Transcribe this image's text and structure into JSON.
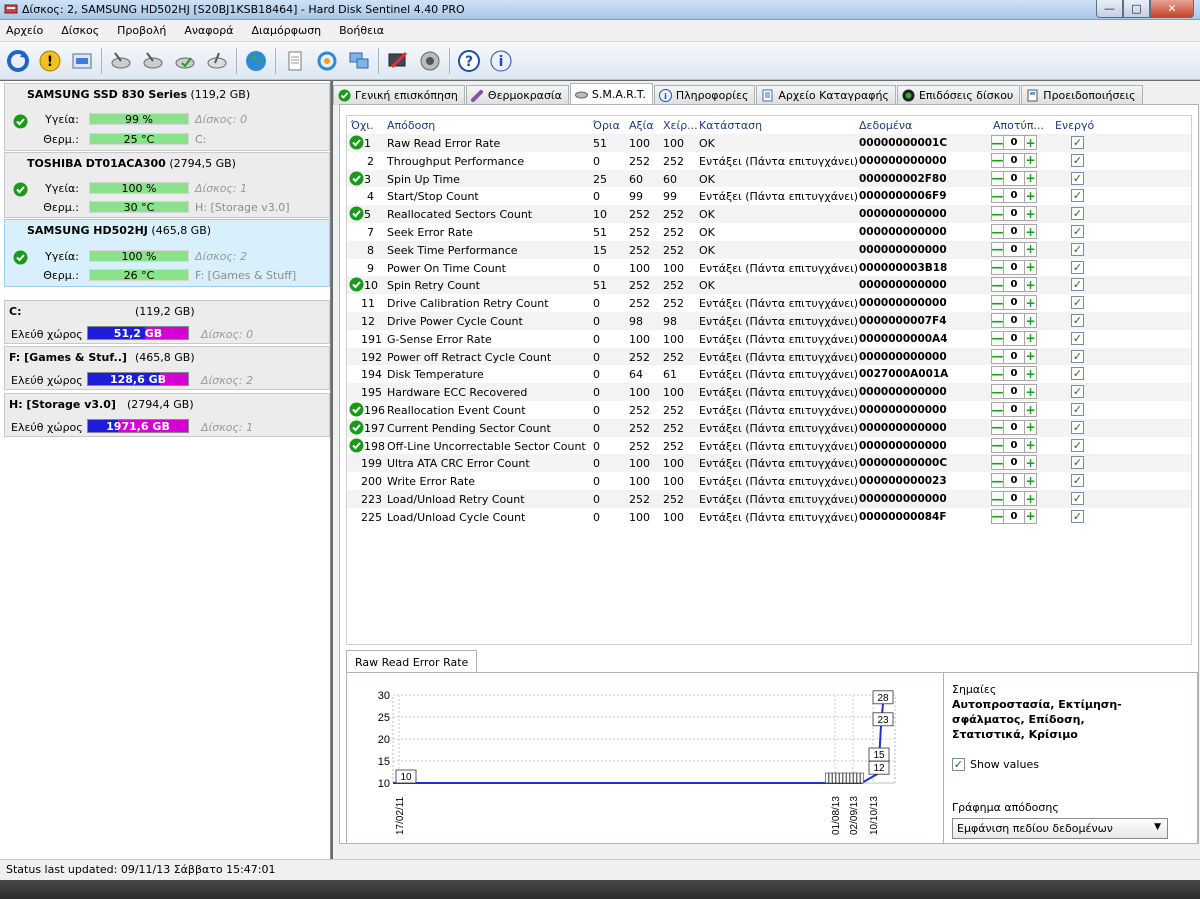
{
  "window": {
    "title": "Δίσκος: 2, SAMSUNG HD502HJ [S20BJ1KSB18464]  -  Hard Disk Sentinel 4.40 PRO"
  },
  "menu": [
    "Αρχείο",
    "Δίσκος",
    "Προβολή",
    "Αναφορά",
    "Διαμόρφωση",
    "Βοήθεια"
  ],
  "disks": [
    {
      "name": "SAMSUNG SSD 830 Series",
      "size": "(119,2 GB)",
      "health_label": "Υγεία:",
      "health": "99 %",
      "health_pct": 99,
      "disk_note": "Δίσκος: 0",
      "temp_label": "Θερμ.:",
      "temp": "25 °C",
      "vol_note": "C:"
    },
    {
      "name": "TOSHIBA DT01ACA300",
      "size": "(2794,5 GB)",
      "health_label": "Υγεία:",
      "health": "100 %",
      "health_pct": 100,
      "disk_note": "Δίσκος: 1",
      "temp_label": "Θερμ.:",
      "temp": "30 °C",
      "vol_note": "H: [Storage v3.0]"
    },
    {
      "name": "SAMSUNG HD502HJ",
      "size": "(465,8 GB)",
      "health_label": "Υγεία:",
      "health": "100 %",
      "health_pct": 100,
      "disk_note": "Δίσκος: 2",
      "temp_label": "Θερμ.:",
      "temp": "26 °C",
      "vol_note": "F: [Games & Stuff]"
    }
  ],
  "volumes": [
    {
      "name": "C:",
      "size": "(119,2 GB)",
      "free_label": "Ελεύθ χώρος",
      "free": "51,2 GB",
      "note": "Δίσκος: 0"
    },
    {
      "name": "F: [Games & Stuf..]",
      "size": "(465,8 GB)",
      "free_label": "Ελεύθ χώρος",
      "free": "128,6 GB",
      "note": "Δίσκος: 2"
    },
    {
      "name": "H: [Storage v3.0]",
      "size": "(2794,4 GB)",
      "free_label": "Ελεύθ χώρος",
      "free": "1971,6 GB",
      "note": "Δίσκος: 1"
    }
  ],
  "tabs": [
    "Γενική επισκόπηση",
    "Θερμοκρασία",
    "S.M.A.R.T.",
    "Πληροφορίες",
    "Αρχείο Καταγραφής",
    "Επιδόσεις δίσκου",
    "Προειδοποιήσεις"
  ],
  "smart": {
    "headers": {
      "id": "Όχι.",
      "name": "Απόδοση",
      "thr": "Όρια",
      "val": "Αξία",
      "worst": "Χείρ...",
      "status": "Κατάσταση",
      "data": "Δεδομένα",
      "off": "Αποτύπ...",
      "en": "Ενεργό"
    },
    "rows": [
      {
        "ok": true,
        "id": "1",
        "name": "Raw Read Error Rate",
        "thr": "51",
        "val": "100",
        "worst": "100",
        "status": "OK",
        "data": "00000000001C"
      },
      {
        "ok": false,
        "id": "2",
        "name": "Throughput Performance",
        "thr": "0",
        "val": "252",
        "worst": "252",
        "status": "Εντάξει (Πάντα επιτυγχάνει)",
        "data": "000000000000"
      },
      {
        "ok": true,
        "id": "3",
        "name": "Spin Up Time",
        "thr": "25",
        "val": "60",
        "worst": "60",
        "status": "OK",
        "data": "000000002F80"
      },
      {
        "ok": false,
        "id": "4",
        "name": "Start/Stop Count",
        "thr": "0",
        "val": "99",
        "worst": "99",
        "status": "Εντάξει (Πάντα επιτυγχάνει)",
        "data": "0000000006F9"
      },
      {
        "ok": true,
        "id": "5",
        "name": "Reallocated Sectors Count",
        "thr": "10",
        "val": "252",
        "worst": "252",
        "status": "OK",
        "data": "000000000000"
      },
      {
        "ok": false,
        "id": "7",
        "name": "Seek Error Rate",
        "thr": "51",
        "val": "252",
        "worst": "252",
        "status": "OK",
        "data": "000000000000"
      },
      {
        "ok": false,
        "id": "8",
        "name": "Seek Time Performance",
        "thr": "15",
        "val": "252",
        "worst": "252",
        "status": "OK",
        "data": "000000000000"
      },
      {
        "ok": false,
        "id": "9",
        "name": "Power On Time Count",
        "thr": "0",
        "val": "100",
        "worst": "100",
        "status": "Εντάξει (Πάντα επιτυγχάνει)",
        "data": "000000003B18"
      },
      {
        "ok": true,
        "id": "10",
        "name": "Spin Retry Count",
        "thr": "51",
        "val": "252",
        "worst": "252",
        "status": "OK",
        "data": "000000000000"
      },
      {
        "ok": false,
        "id": "11",
        "name": "Drive Calibration Retry Count",
        "thr": "0",
        "val": "252",
        "worst": "252",
        "status": "Εντάξει (Πάντα επιτυγχάνει)",
        "data": "000000000000"
      },
      {
        "ok": false,
        "id": "12",
        "name": "Drive Power Cycle Count",
        "thr": "0",
        "val": "98",
        "worst": "98",
        "status": "Εντάξει (Πάντα επιτυγχάνει)",
        "data": "0000000007F4"
      },
      {
        "ok": false,
        "id": "191",
        "name": "G-Sense Error Rate",
        "thr": "0",
        "val": "100",
        "worst": "100",
        "status": "Εντάξει (Πάντα επιτυγχάνει)",
        "data": "0000000000A4"
      },
      {
        "ok": false,
        "id": "192",
        "name": "Power off Retract Cycle Count",
        "thr": "0",
        "val": "252",
        "worst": "252",
        "status": "Εντάξει (Πάντα επιτυγχάνει)",
        "data": "000000000000"
      },
      {
        "ok": false,
        "id": "194",
        "name": "Disk Temperature",
        "thr": "0",
        "val": "64",
        "worst": "61",
        "status": "Εντάξει (Πάντα επιτυγχάνει)",
        "data": "0027000A001A"
      },
      {
        "ok": false,
        "id": "195",
        "name": "Hardware ECC Recovered",
        "thr": "0",
        "val": "100",
        "worst": "100",
        "status": "Εντάξει (Πάντα επιτυγχάνει)",
        "data": "000000000000"
      },
      {
        "ok": true,
        "id": "196",
        "name": "Reallocation Event Count",
        "thr": "0",
        "val": "252",
        "worst": "252",
        "status": "Εντάξει (Πάντα επιτυγχάνει)",
        "data": "000000000000"
      },
      {
        "ok": true,
        "id": "197",
        "name": "Current Pending Sector Count",
        "thr": "0",
        "val": "252",
        "worst": "252",
        "status": "Εντάξει (Πάντα επιτυγχάνει)",
        "data": "000000000000"
      },
      {
        "ok": true,
        "id": "198",
        "name": "Off-Line Uncorrectable Sector Count",
        "thr": "0",
        "val": "252",
        "worst": "252",
        "status": "Εντάξει (Πάντα επιτυγχάνει)",
        "data": "000000000000"
      },
      {
        "ok": false,
        "id": "199",
        "name": "Ultra ATA CRC Error Count",
        "thr": "0",
        "val": "100",
        "worst": "100",
        "status": "Εντάξει (Πάντα επιτυγχάνει)",
        "data": "00000000000C"
      },
      {
        "ok": false,
        "id": "200",
        "name": "Write Error Rate",
        "thr": "0",
        "val": "100",
        "worst": "100",
        "status": "Εντάξει (Πάντα επιτυγχάνει)",
        "data": "000000000023"
      },
      {
        "ok": false,
        "id": "223",
        "name": "Load/Unload Retry Count",
        "thr": "0",
        "val": "252",
        "worst": "252",
        "status": "Εντάξει (Πάντα επιτυγχάνει)",
        "data": "000000000000"
      },
      {
        "ok": false,
        "id": "225",
        "name": "Load/Unload Cycle Count",
        "thr": "0",
        "val": "100",
        "worst": "100",
        "status": "Εντάξει (Πάντα επιτυγχάνει)",
        "data": "00000000084F"
      }
    ],
    "offset_value": "0"
  },
  "chart_panel": {
    "tab": "Raw Read Error Rate",
    "flags_label": "Σημαίες",
    "flags_value": "Αυτοπροστασία, Εκτίμηση-σφάλματος, Επίδοση, Στατιστικά, Κρίσιμο",
    "show_values": "Show values",
    "graph_label": "Γράφημα απόδοσης",
    "graph_select": "Εμφάνιση πεδίου δεδομένων"
  },
  "chart_data": {
    "type": "line",
    "title": "",
    "ylim": [
      10,
      30
    ],
    "yticks": [
      10,
      15,
      20,
      25,
      30
    ],
    "xticks": [
      "17/02/11",
      "01/08/13",
      "02/09/13",
      "10/10/13"
    ],
    "series": [
      {
        "values": [
          10,
          10,
          10,
          10,
          10,
          10,
          10,
          10,
          10,
          10,
          10,
          10,
          12,
          15,
          23,
          28
        ]
      }
    ],
    "value_labels": [
      "10",
      "12",
      "15",
      "23",
      "28"
    ]
  },
  "status": "Status last updated: 09/11/13 Σάββατο 15:47:01",
  "colors": {
    "health": "#8ae38a",
    "free_used": "#1e1ed8",
    "free_rest": "#d400d4",
    "selected": "#d7f0fb"
  }
}
